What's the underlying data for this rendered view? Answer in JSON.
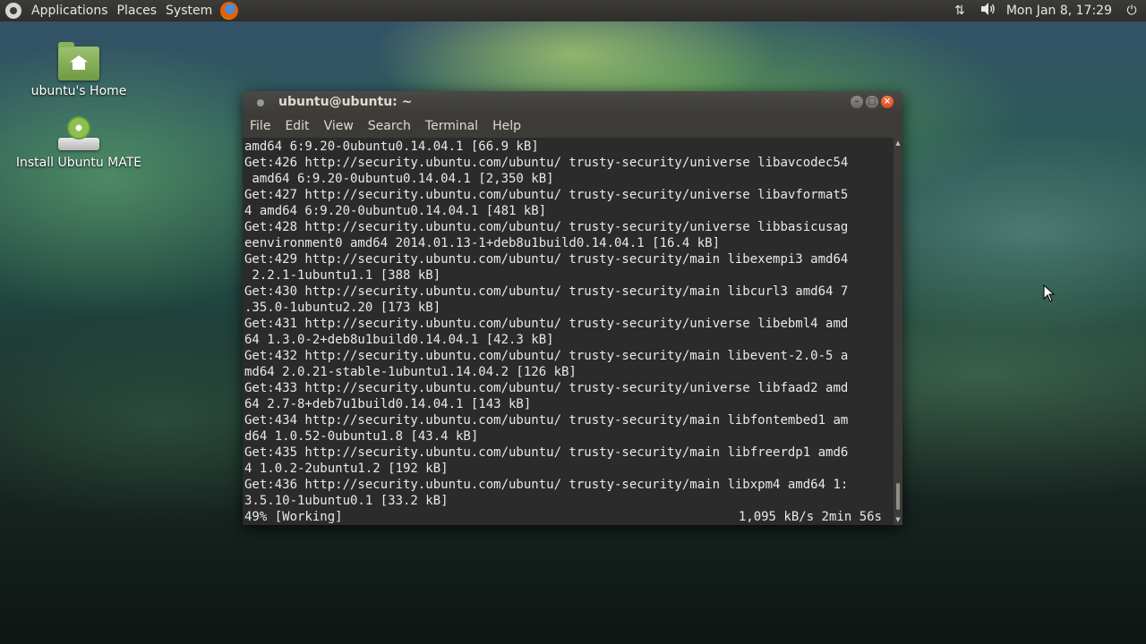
{
  "top_panel": {
    "menus": [
      "Applications",
      "Places",
      "System"
    ],
    "clock": "Mon Jan 8, 17:29",
    "tray_icons": [
      "network-transfer-icon",
      "volume-icon",
      "power-icon"
    ]
  },
  "desktop_icons": [
    {
      "label": "ubuntu's Home",
      "icon": "home-folder-icon"
    },
    {
      "label": "Install Ubuntu MATE",
      "icon": "install-disc-icon"
    }
  ],
  "terminal": {
    "title": "ubuntu@ubuntu: ~",
    "menu": [
      "File",
      "Edit",
      "View",
      "Search",
      "Terminal",
      "Help"
    ],
    "lines": [
      "amd64 6:9.20-0ubuntu0.14.04.1 [66.9 kB]",
      "Get:426 http://security.ubuntu.com/ubuntu/ trusty-security/universe libavcodec54",
      " amd64 6:9.20-0ubuntu0.14.04.1 [2,350 kB]",
      "Get:427 http://security.ubuntu.com/ubuntu/ trusty-security/universe libavformat5",
      "4 amd64 6:9.20-0ubuntu0.14.04.1 [481 kB]",
      "Get:428 http://security.ubuntu.com/ubuntu/ trusty-security/universe libbasicusag",
      "eenvironment0 amd64 2014.01.13-1+deb8u1build0.14.04.1 [16.4 kB]",
      "Get:429 http://security.ubuntu.com/ubuntu/ trusty-security/main libexempi3 amd64",
      " 2.2.1-1ubuntu1.1 [388 kB]",
      "Get:430 http://security.ubuntu.com/ubuntu/ trusty-security/main libcurl3 amd64 7",
      ".35.0-1ubuntu2.20 [173 kB]",
      "Get:431 http://security.ubuntu.com/ubuntu/ trusty-security/universe libebml4 amd",
      "64 1.3.0-2+deb8u1build0.14.04.1 [42.3 kB]",
      "Get:432 http://security.ubuntu.com/ubuntu/ trusty-security/main libevent-2.0-5 a",
      "md64 2.0.21-stable-1ubuntu1.14.04.2 [126 kB]",
      "Get:433 http://security.ubuntu.com/ubuntu/ trusty-security/universe libfaad2 amd",
      "64 2.7-8+deb7u1build0.14.04.1 [143 kB]",
      "Get:434 http://security.ubuntu.com/ubuntu/ trusty-security/main libfontembed1 am",
      "d64 1.0.52-0ubuntu1.8 [43.4 kB]",
      "Get:435 http://security.ubuntu.com/ubuntu/ trusty-security/main libfreerdp1 amd6",
      "4 1.0.2-2ubuntu1.2 [192 kB]",
      "Get:436 http://security.ubuntu.com/ubuntu/ trusty-security/main libxpm4 amd64 1:",
      "3.5.10-1ubuntu0.1 [33.2 kB]"
    ],
    "status_left": "49% [Working]",
    "status_right": "1,095 kB/s 2min 56s"
  }
}
